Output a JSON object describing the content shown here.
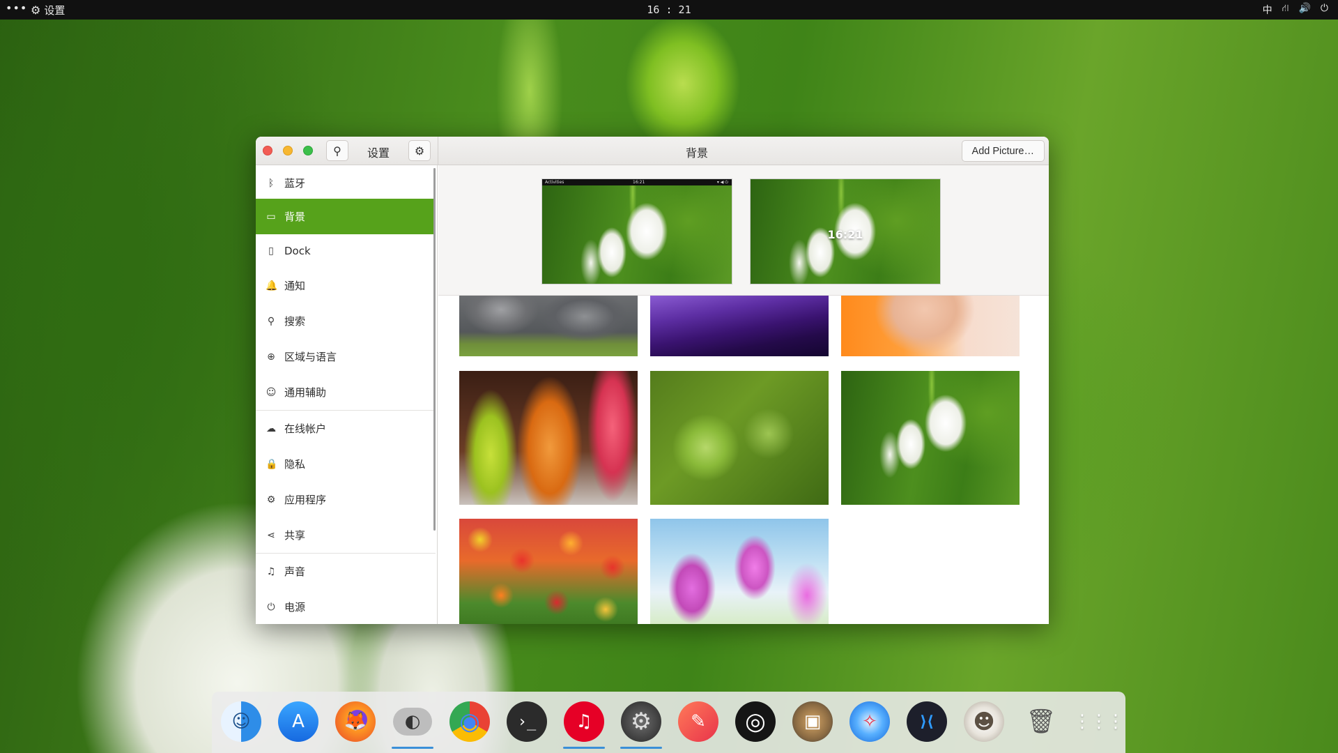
{
  "topbar": {
    "dots": "•••",
    "app_icon": "gear-icon",
    "app_name": "设置",
    "clock": "16 : 21",
    "tray": [
      {
        "name": "input-method",
        "label": "中"
      },
      {
        "name": "network-icon",
        "label": "⛙"
      },
      {
        "name": "volume-icon",
        "label": "🔊"
      },
      {
        "name": "power-icon",
        "label": "⏻"
      }
    ]
  },
  "window": {
    "sidebar_title": "设置",
    "main_title": "背景",
    "add_button": "Add Picture…",
    "colors": {
      "accent": "#56a21b"
    }
  },
  "sidebar": {
    "items": [
      {
        "icon": "bluetooth-icon",
        "glyph": "ᛒ",
        "label": "蓝牙"
      },
      {
        "icon": "display-icon",
        "glyph": "▭",
        "label": "背景"
      },
      {
        "icon": "dock-icon",
        "glyph": "▯",
        "label": "Dock"
      },
      {
        "icon": "bell-icon",
        "glyph": "🔔",
        "label": "通知"
      },
      {
        "icon": "search-icon",
        "glyph": "⚲",
        "label": "搜索"
      },
      {
        "icon": "globe-icon",
        "glyph": "⊕",
        "label": "区域与语言"
      },
      {
        "icon": "accessibility-icon",
        "glyph": "☺",
        "label": "通用辅助"
      },
      {
        "icon": "cloud-icon",
        "glyph": "☁",
        "label": "在线帐户"
      },
      {
        "icon": "lock-icon",
        "glyph": "🔒",
        "label": "隐私"
      },
      {
        "icon": "apps-icon",
        "glyph": "⚙",
        "label": "应用程序"
      },
      {
        "icon": "share-icon",
        "glyph": "⋖",
        "label": "共享"
      },
      {
        "icon": "music-icon",
        "glyph": "♫",
        "label": "声音"
      },
      {
        "icon": "power-icon",
        "glyph": "⏻",
        "label": "电源"
      }
    ]
  },
  "preview": {
    "desktop_bar": {
      "left": "Activities",
      "center": "16:21",
      "right": "▾ ◀ ⏻"
    },
    "lock_time": "16:21"
  },
  "wallpapers": [
    {
      "name": "wallpaper-koala"
    },
    {
      "name": "wallpaper-purple-hills"
    },
    {
      "name": "wallpaper-woman-orange"
    },
    {
      "name": "wallpaper-bottles"
    },
    {
      "name": "wallpaper-grapes"
    },
    {
      "name": "wallpaper-snowdrops"
    },
    {
      "name": "wallpaper-tulips"
    },
    {
      "name": "wallpaper-pink-tulips"
    }
  ],
  "dock": {
    "items": [
      {
        "name": "finder-icon",
        "glyph": "☺",
        "color": "#2e8de8",
        "running": false
      },
      {
        "name": "app-store-icon",
        "glyph": "A",
        "color": "#1f8ff0",
        "running": false
      },
      {
        "name": "firefox-icon",
        "glyph": "🦊",
        "color": "#f57c22",
        "running": false
      },
      {
        "name": "toggle-app-icon",
        "glyph": "◐",
        "color": "#6e6e6e",
        "running": true
      },
      {
        "name": "chrome-icon",
        "glyph": "◉",
        "color": "#e94235",
        "running": false
      },
      {
        "name": "terminal-icon",
        "glyph": "›_",
        "color": "#2b2b2b",
        "running": false
      },
      {
        "name": "netease-music-icon",
        "glyph": "♫",
        "color": "#e60026",
        "running": true
      },
      {
        "name": "settings-icon",
        "glyph": "⚙",
        "color": "#8e8e8e",
        "running": true
      },
      {
        "name": "pencil-app-icon",
        "glyph": "✎",
        "color": "#f0504a",
        "running": false
      },
      {
        "name": "obs-icon",
        "glyph": "◎",
        "color": "#1b1b1b",
        "running": false
      },
      {
        "name": "package-icon",
        "glyph": "▣",
        "color": "#8a6a42",
        "running": false
      },
      {
        "name": "safari-icon",
        "glyph": "✧",
        "color": "#1e7ee8",
        "running": false
      },
      {
        "name": "vscode-icon",
        "glyph": "⟩⟨",
        "color": "#1479c9",
        "running": false
      },
      {
        "name": "gimp-icon",
        "glyph": "☻",
        "color": "#e8e4dc",
        "running": false
      },
      {
        "name": "trash-icon",
        "glyph": "🗑",
        "color": "#5a5a5a",
        "running": false
      },
      {
        "name": "app-grid-icon",
        "glyph": "⋮⋮⋮",
        "color": "#e0e0e0",
        "running": false
      }
    ]
  }
}
